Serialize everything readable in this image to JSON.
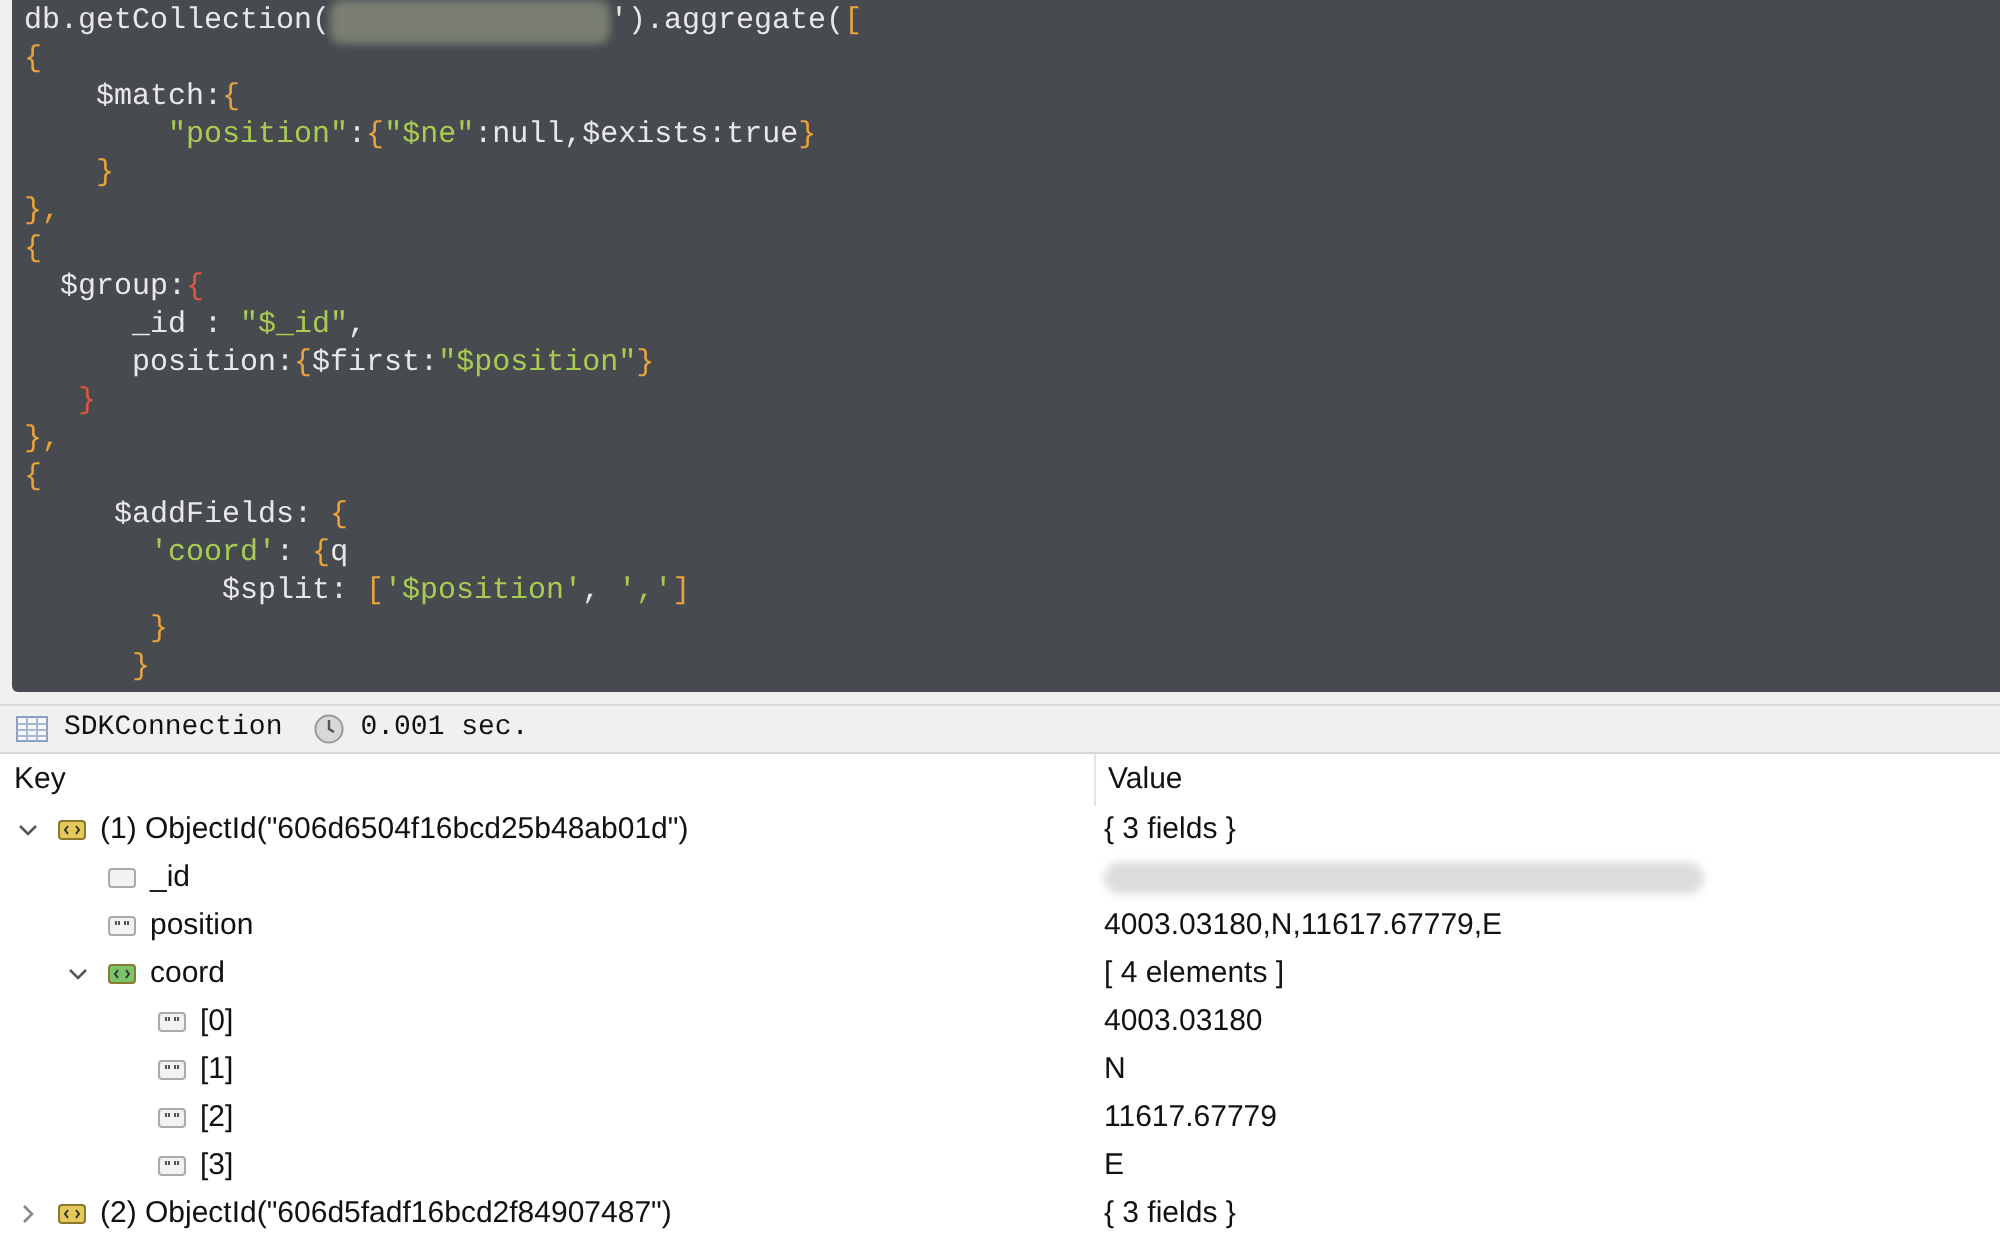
{
  "editor": {
    "lines": [
      [
        {
          "kind": "text",
          "text": "db.getCollection("
        },
        {
          "kind": "redacted"
        },
        {
          "kind": "text",
          "text": "').aggregate("
        },
        {
          "kind": "punct",
          "text": "["
        }
      ],
      [
        {
          "kind": "punct",
          "text": "{"
        }
      ],
      [
        {
          "kind": "text",
          "text": "    $match:"
        },
        {
          "kind": "punct",
          "text": "{"
        }
      ],
      [
        {
          "kind": "string",
          "text": "        \"position\""
        },
        {
          "kind": "text",
          "text": ":"
        },
        {
          "kind": "punct",
          "text": "{"
        },
        {
          "kind": "string",
          "text": "\"$ne\""
        },
        {
          "kind": "text",
          "text": ":null,$exists:true"
        },
        {
          "kind": "punct",
          "text": "}"
        }
      ],
      [
        {
          "kind": "punct",
          "text": "    }"
        }
      ],
      [
        {
          "kind": "punct",
          "text": "},"
        }
      ],
      [
        {
          "kind": "punct",
          "text": "{"
        }
      ],
      [
        {
          "kind": "text",
          "text": "  $group:"
        },
        {
          "kind": "red",
          "text": "{"
        }
      ],
      [
        {
          "kind": "text",
          "text": "      _id : "
        },
        {
          "kind": "string",
          "text": "\"$_id\""
        },
        {
          "kind": "text",
          "text": ","
        }
      ],
      [
        {
          "kind": "text",
          "text": "      position:"
        },
        {
          "kind": "punct",
          "text": "{"
        },
        {
          "kind": "text",
          "text": "$first:"
        },
        {
          "kind": "string",
          "text": "\"$position\""
        },
        {
          "kind": "punct",
          "text": "}"
        }
      ],
      [
        {
          "kind": "red",
          "text": "   }"
        }
      ],
      [
        {
          "kind": "punct",
          "text": "},"
        }
      ],
      [
        {
          "kind": "punct",
          "text": "{"
        }
      ],
      [
        {
          "kind": "text",
          "text": "     $addFields: "
        },
        {
          "kind": "punct",
          "text": "{"
        }
      ],
      [
        {
          "kind": "string",
          "text": "       'coord'"
        },
        {
          "kind": "text",
          "text": ": "
        },
        {
          "kind": "punct",
          "text": "{"
        },
        {
          "kind": "text",
          "text": "q"
        }
      ],
      [
        {
          "kind": "text",
          "text": "           $split: "
        },
        {
          "kind": "punct",
          "text": "["
        },
        {
          "kind": "string",
          "text": "'$position'"
        },
        {
          "kind": "text",
          "text": ", "
        },
        {
          "kind": "string",
          "text": "','"
        },
        {
          "kind": "punct",
          "text": "]"
        }
      ],
      [
        {
          "kind": "punct",
          "text": "       }"
        }
      ],
      [
        {
          "kind": "punct",
          "text": "      }"
        }
      ]
    ]
  },
  "status_bar": {
    "connection": "SDKConnection",
    "time": "0.001 sec."
  },
  "results": {
    "columns": [
      "Key",
      "Value"
    ],
    "rows": [
      {
        "kind": "object",
        "key": "(1) ObjectId(\"606d6504f16bcd25b48ab01d\")",
        "value": "{ 3 fields }",
        "expanded": true,
        "children": [
          {
            "kind": "id",
            "key": "_id",
            "value_redacted": true
          },
          {
            "kind": "string",
            "key": "position",
            "value": "4003.03180,N,11617.67779,E"
          },
          {
            "kind": "array",
            "key": "coord",
            "value": "[ 4 elements ]",
            "expanded": true,
            "children": [
              {
                "kind": "string",
                "key": "[0]",
                "value": "4003.03180"
              },
              {
                "kind": "string",
                "key": "[1]",
                "value": "N"
              },
              {
                "kind": "string",
                "key": "[2]",
                "value": "11617.67779"
              },
              {
                "kind": "string",
                "key": "[3]",
                "value": "E"
              }
            ]
          }
        ]
      },
      {
        "kind": "object",
        "key": "(2) ObjectId(\"606d5fadf16bcd2f84907487\")",
        "value": "{ 3 fields }",
        "expanded": false
      }
    ]
  }
}
